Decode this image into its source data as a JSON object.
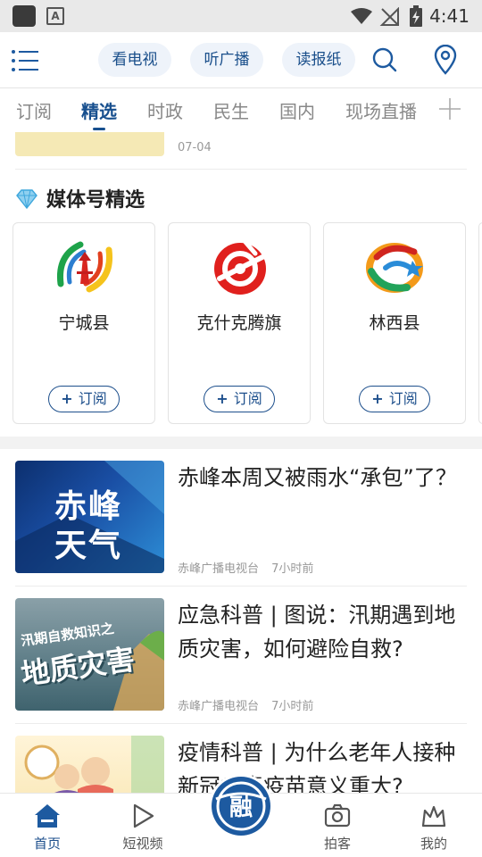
{
  "status_bar": {
    "time": "4:41"
  },
  "header": {
    "tv_label": "看电视",
    "radio_label": "听广播",
    "paper_label": "读报纸"
  },
  "tabs": [
    {
      "label": "订阅"
    },
    {
      "label": "精选"
    },
    {
      "label": "时政"
    },
    {
      "label": "民生"
    },
    {
      "label": "国内"
    },
    {
      "label": "现场直播"
    }
  ],
  "partial_item": {
    "date": "07-04"
  },
  "media_section": {
    "title": "媒体号精选",
    "cards": [
      {
        "name": "宁城县",
        "subscribe_label": "订阅"
      },
      {
        "name": "克什克腾旗",
        "subscribe_label": "订阅"
      },
      {
        "name": "林西县",
        "subscribe_label": "订阅"
      }
    ]
  },
  "news": [
    {
      "title": "赤峰本周又被雨水“承包”了？",
      "source": "赤峰广播电视台",
      "time": "7小时前",
      "thumb_line1": "赤峰",
      "thumb_line2": "天气"
    },
    {
      "title": "应急科普 | 图说：汛期遇到地质灾害，如何避险自救?",
      "source": "赤峰广播电视台",
      "time": "7小时前",
      "thumb_line1": "汛期自救知识之",
      "thumb_line2": "地质灾害"
    },
    {
      "title": "疫情科普 | 为什么老年人接种新冠病毒疫苗意义重大?"
    }
  ],
  "bottom_nav": {
    "home": "首页",
    "video": "短视频",
    "center_glyph": "融",
    "shoot": "拍客",
    "mine": "我的"
  },
  "colors": {
    "brand_blue": "#1d4f8c",
    "pill_bg": "#eef3fa",
    "tab_inactive": "#888888"
  }
}
